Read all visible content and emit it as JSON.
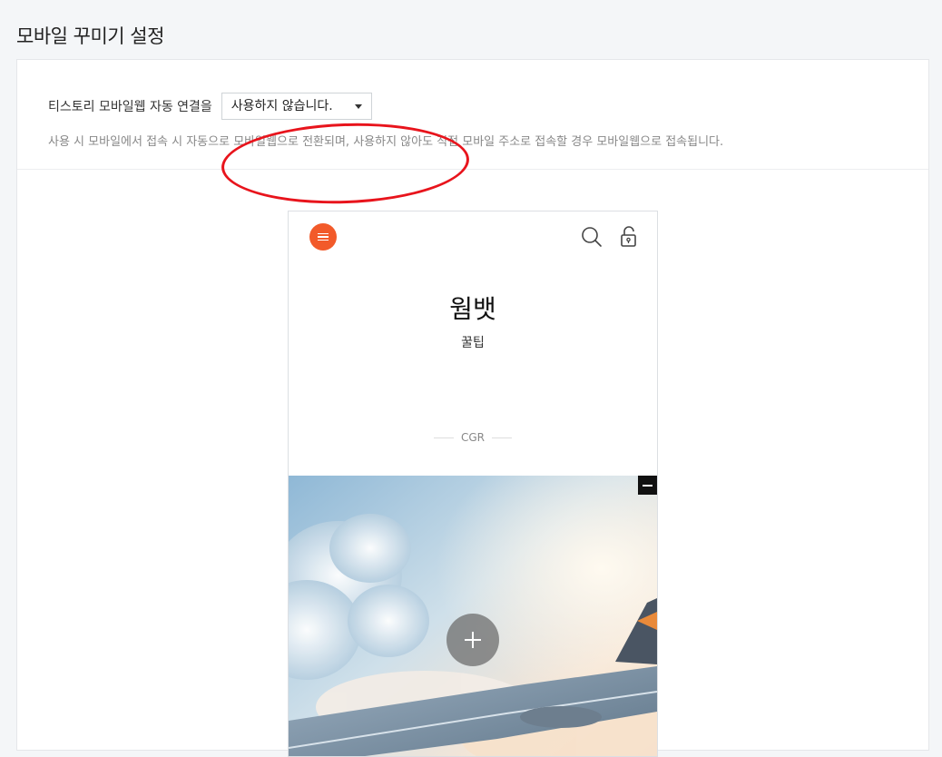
{
  "page": {
    "title": "모바일 꾸미기 설정"
  },
  "mobile_web": {
    "label": "티스토리 모바일웹 자동 연결을",
    "select_value": "사용하지 않습니다.",
    "description": "사용 시 모바일에서 접속 시 자동으로 모바일웹으로 전환되며, 사용하지 않아도 직접 모바일 주소로 접속할 경우 모바일웹으로 접속됩니다."
  },
  "preview": {
    "blog_title": "웜뱃",
    "blog_description": "꿀팁",
    "category": "CGR",
    "icons": {
      "menu": "menu-icon",
      "search": "search-icon",
      "lock": "unlock-icon",
      "collapse": "minus-icon",
      "add": "plus-icon"
    }
  },
  "colors": {
    "accent_orange": "#f25a2a",
    "highlight_red": "#e8141c"
  }
}
